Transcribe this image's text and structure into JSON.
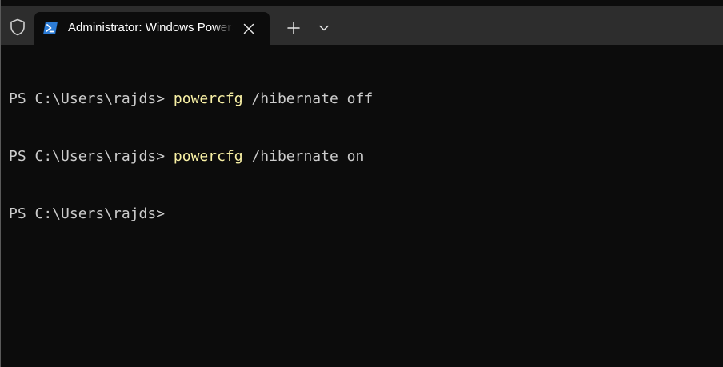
{
  "window": {
    "tab_title": "Administrator: Windows PowerShell",
    "tab_icon": "powershell-icon",
    "shield_icon": "admin-shield-icon",
    "close_icon": "close-icon",
    "new_tab_icon": "plus-icon",
    "dropdown_icon": "chevron-down-icon"
  },
  "terminal": {
    "lines": [
      {
        "prompt": "PS C:\\Users\\rajds> ",
        "command": "powercfg",
        "args": " /hibernate off"
      },
      {
        "prompt": "PS C:\\Users\\rajds> ",
        "command": "powercfg",
        "args": " /hibernate on"
      },
      {
        "prompt": "PS C:\\Users\\rajds>",
        "command": "",
        "args": ""
      }
    ]
  },
  "colors": {
    "terminal_background": "#0c0c0c",
    "titlebar_background": "#2d2d2d",
    "text": "#cccccc",
    "command": "#f9f1a5",
    "powershell_blue": "#2c7cd6"
  }
}
